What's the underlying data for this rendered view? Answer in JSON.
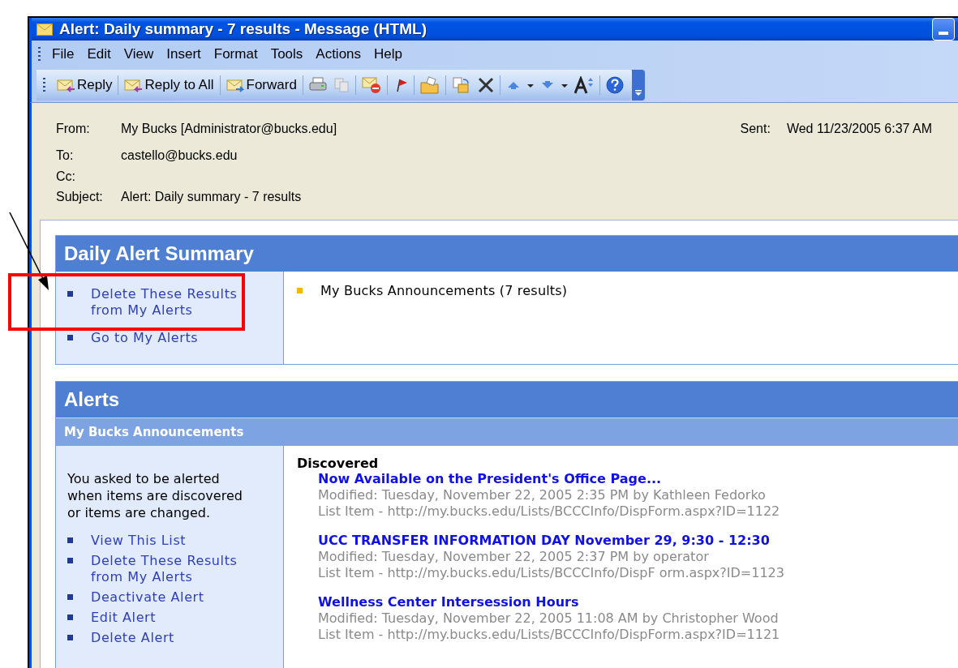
{
  "window": {
    "title": "Alert: Daily summary - 7 results - Message (HTML)"
  },
  "menu": [
    {
      "label": "File"
    },
    {
      "label": "Edit"
    },
    {
      "label": "View"
    },
    {
      "label": "Insert"
    },
    {
      "label": "Format"
    },
    {
      "label": "Tools"
    },
    {
      "label": "Actions"
    },
    {
      "label": "Help"
    }
  ],
  "toolbar": [
    {
      "kind": "reply",
      "label": "Reply"
    },
    {
      "kind": "replyall",
      "label": "Reply to All"
    },
    {
      "kind": "forward",
      "label": "Forward"
    }
  ],
  "header": {
    "fields": [
      {
        "label": "From:",
        "value": "My Bucks [Administrator@bucks.edu]"
      },
      {
        "label": "To:",
        "value": "castello@bucks.edu"
      },
      {
        "label": "Cc:"
      },
      {
        "label": "Subject:",
        "value": "Alert: Daily summary - 7 results"
      }
    ],
    "sent": {
      "label": "Sent:",
      "value": "Wed 11/23/2005 6:37 AM"
    }
  },
  "summary": {
    "title": "Daily Alert Summary",
    "links": [
      "Delete These Results from My Alerts",
      "Go to My Alerts"
    ],
    "items": [
      "My Bucks Announcements (7 results)"
    ]
  },
  "alerts": {
    "title": "Alerts",
    "subtitle": "My Bucks Announcements",
    "description": "You asked to be alerted when items are discovered or items are changed.",
    "links": [
      "View This List",
      "Delete These Results from My Alerts",
      "Deactivate Alert",
      "Edit Alert",
      "Delete Alert"
    ],
    "section": "Discovered",
    "results": [
      {
        "title": "Now Available on the President's Office Page...",
        "modified": "Modified: Tuesday, November 22, 2005 2:35 PM by Kathleen Fedorko",
        "url": "List Item - http://my.bucks.edu/Lists/BCCCInfo/DispForm.aspx?ID=1122"
      },
      {
        "title": "UCC TRANSFER INFORMATION DAY November 29, 9:30 - 12:30",
        "modified": "Modified: Tuesday, November 22, 2005 2:37 PM by operator",
        "url": "List Item - http://my.bucks.edu/Lists/BCCCInfo/DispF orm.aspx?ID=1123"
      },
      {
        "title": "Wellness Center Intersession Hours",
        "modified": "Modified: Tuesday, November 22, 2005 11:08 AM by Christopher Wood",
        "url": "List Item - http://my.bucks.edu/Lists/BCCCInfo/DispForm.aspx?ID=1121"
      }
    ]
  }
}
